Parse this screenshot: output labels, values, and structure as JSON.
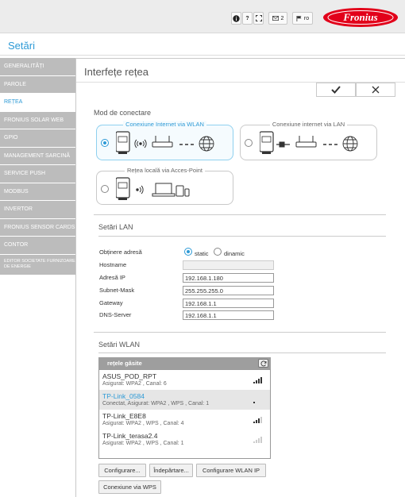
{
  "topbar": {
    "info_icon": "info-icon",
    "help_label": "?",
    "fullscreen_icon": "expand-icon",
    "mail_count": "2",
    "language": "ro",
    "brand": "Fronius",
    "brand_color": "#e2001a"
  },
  "page": {
    "title": "Setări",
    "accent_color": "#2d9ad6"
  },
  "sidebar": {
    "items": [
      {
        "label": "GENERALITĂȚI"
      },
      {
        "label": "PAROLE"
      },
      {
        "label": "REȚEA",
        "active": true
      },
      {
        "label": "FRONIUS SOLAR WEB"
      },
      {
        "label": "GPIO"
      },
      {
        "label": "MANAGEMENT SARCINĂ"
      },
      {
        "label": "SERVICE PUSH"
      },
      {
        "label": "MODBUS"
      },
      {
        "label": "INVERTOR"
      },
      {
        "label": "FRONIUS SENSOR CARDS"
      },
      {
        "label": "CONTOR"
      },
      {
        "label": "EDITOR SOCIETATE FURNIZOARE DE ENERGIE"
      }
    ]
  },
  "panel": {
    "title": "Interfețe rețea",
    "confirm_icon": "checkmark-icon",
    "cancel_icon": "close-icon"
  },
  "connection": {
    "heading": "Mod de conectare",
    "modes": [
      {
        "label": "Conexiune Internet via WLAN",
        "selected": true
      },
      {
        "label": "Conexiune internet via LAN",
        "selected": false
      },
      {
        "label": "Rețea locală via Acces-Point",
        "selected": false
      }
    ]
  },
  "lan": {
    "heading": "Setări LAN",
    "address_label": "Obținere adresă",
    "static_label": "static",
    "dynamic_label": "dinamic",
    "address_mode": "static",
    "hostname_label": "Hostname",
    "hostname": "",
    "ip_label": "Adresă IP",
    "ip": "192.168.1.180",
    "mask_label": "Subnet-Mask",
    "mask": "255.255.255.0",
    "gateway_label": "Gateway",
    "gateway": "192.168.1.1",
    "dns_label": "DNS-Server",
    "dns": "192.168.1.1"
  },
  "wlan": {
    "heading": "Setări WLAN",
    "list_title": "rețele găsite",
    "networks": [
      {
        "name": "ASUS_POD_RPT",
        "desc": "Asigurat: WPA2 , Canal: 6",
        "signal": 4,
        "selected": false
      },
      {
        "name": "TP-Link_0584",
        "desc": "Conectat, Asigurat: WPA2 , WPS , Canal: 1",
        "signal": 1,
        "selected": true
      },
      {
        "name": "TP-Link_E8E8",
        "desc": "Asigurat: WPA2 , WPS , Canal: 4",
        "signal": 3,
        "selected": false
      },
      {
        "name": "TP-Link_terasa2.4",
        "desc": "Asigurat: WPA2 , WPS , Canal: 1",
        "signal": 0,
        "selected": false
      }
    ],
    "buttons": {
      "configure": "Configurare...",
      "remove": "Îndepărtare...",
      "configure_ip": "Configurare WLAN IP",
      "wps": "Conexiune via WPS"
    }
  }
}
